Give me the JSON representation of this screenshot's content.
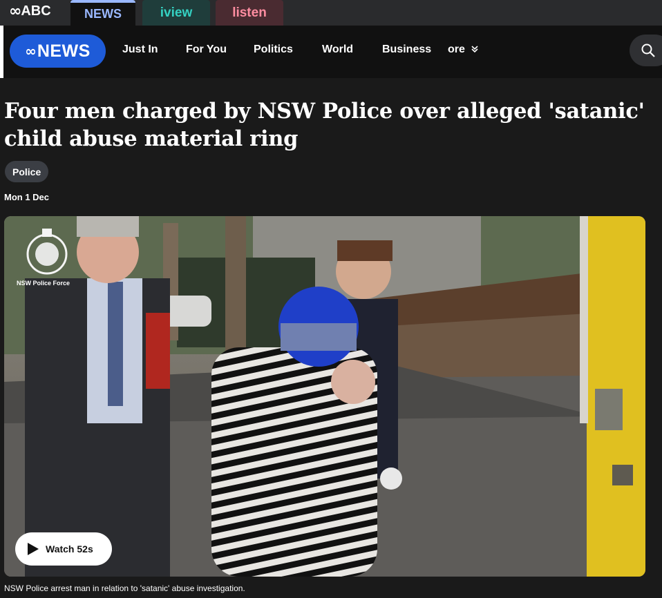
{
  "topbar": {
    "brand_label": "ABC",
    "tabs": [
      {
        "label": "NEWS",
        "color": "#9ab8ff"
      },
      {
        "label": "iview",
        "color": "#34d1c2"
      },
      {
        "label": "listen",
        "color": "#ff8da1"
      }
    ]
  },
  "navbar": {
    "brand_label": "NEWS",
    "brand_color": "#1e5bd8",
    "items": [
      "Just In",
      "For You",
      "Politics",
      "World",
      "Business"
    ],
    "more_label": "ore",
    "more_icon": "chevron-double-down-icon",
    "search_icon": "search-icon"
  },
  "article": {
    "headline": "Four men charged by NSW Police over alleged 'satanic' child abuse material ring",
    "tag": "Police",
    "date": "Mon 1 Dec"
  },
  "video": {
    "watermark": "NSW Police Force",
    "watch_label": "Watch 52s",
    "caption": "NSW Police arrest man in relation to 'satanic' abuse investigation."
  }
}
